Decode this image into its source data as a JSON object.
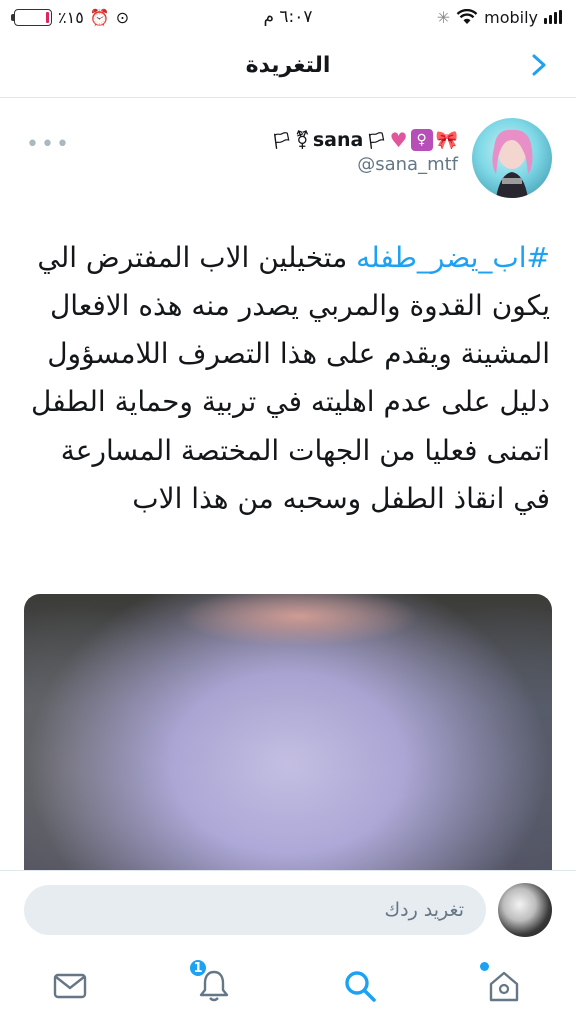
{
  "status_bar": {
    "battery_percent": "٪١٥",
    "time": "٦:٠٧ م",
    "carrier": "mobily",
    "battery_level": 0.15
  },
  "header": {
    "title": "التغريدة"
  },
  "tweet": {
    "author": {
      "display_name": "sana",
      "handle": "@sana_mtf",
      "name_emojis": [
        "🏳️",
        "⚧",
        "🏳️",
        "💗",
        "🚺",
        "🎀"
      ]
    },
    "hashtag": "#اب_يضر_طفله",
    "text": " متخيلين الاب المفترض الي يكون القدوة والمربي يصدر منه هذه الافعال المشينة ويقدم على هذا التصرف اللامسؤول دليل على عدم اهليته في تربية وحماية الطفل اتمنى فعليا من الجهات المختصة المسارعة في انقاذ الطفل وسحبه من هذا الاب",
    "more_label": "•••"
  },
  "reply": {
    "placeholder": "تغريد ردك"
  },
  "tabs": {
    "notifications_badge": "1"
  },
  "colors": {
    "accent": "#1da1f2",
    "text": "#14171a",
    "muted": "#657786",
    "border": "#e1e8ed",
    "input_bg": "#e6ecf0"
  }
}
